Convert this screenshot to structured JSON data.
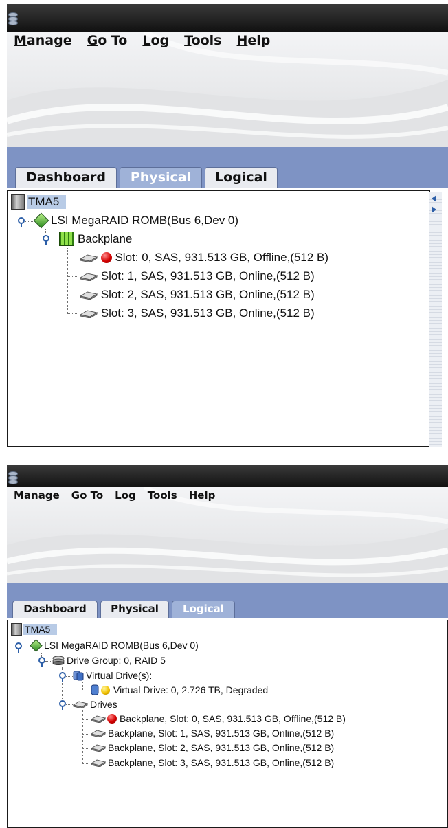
{
  "menu": [
    "Manage",
    "Go To",
    "Log",
    "Tools",
    "Help"
  ],
  "menu_mnemonics": [
    "M",
    "G",
    "L",
    "T",
    "H"
  ],
  "tabs": [
    "Dashboard",
    "Physical",
    "Logical"
  ],
  "physical_view": {
    "active_tab": "Physical",
    "tree": {
      "root": "TMA5",
      "controller": "LSI MegaRAID ROMB(Bus 6,Dev 0)",
      "backplane": "Backplane",
      "slots": [
        {
          "label": "Slot: 0, SAS, 931.513 GB, Offline,(512 B)",
          "status": "red"
        },
        {
          "label": "Slot: 1, SAS, 931.513 GB, Online,(512 B)",
          "status": "none"
        },
        {
          "label": "Slot: 2, SAS, 931.513 GB, Online,(512 B)",
          "status": "none"
        },
        {
          "label": "Slot: 3, SAS, 931.513 GB, Online,(512 B)",
          "status": "none"
        }
      ]
    }
  },
  "logical_view": {
    "active_tab": "Logical",
    "tree": {
      "root": "TMA5",
      "controller": "LSI MegaRAID ROMB(Bus 6,Dev 0)",
      "drive_group": "Drive Group: 0, RAID  5",
      "virtual_drives_label": "Virtual Drive(s):",
      "virtual_drive": {
        "label": "Virtual Drive: 0, 2.726 TB, Degraded",
        "status": "yellow"
      },
      "drives_label": "Drives",
      "drives": [
        {
          "label": "Backplane, Slot: 0, SAS, 931.513 GB, Offline,(512 B)",
          "status": "red"
        },
        {
          "label": "Backplane, Slot: 1, SAS, 931.513 GB, Online,(512 B)",
          "status": "none"
        },
        {
          "label": "Backplane, Slot: 2, SAS, 931.513 GB, Online,(512 B)",
          "status": "none"
        },
        {
          "label": "Backplane, Slot: 3, SAS, 931.513 GB, Online,(512 B)",
          "status": "none"
        }
      ]
    }
  },
  "colors": {
    "tab_strip": "#7e93c4",
    "active_tab": "#9fb2d8",
    "status_red": "#d40000",
    "status_yellow": "#f2c200"
  }
}
